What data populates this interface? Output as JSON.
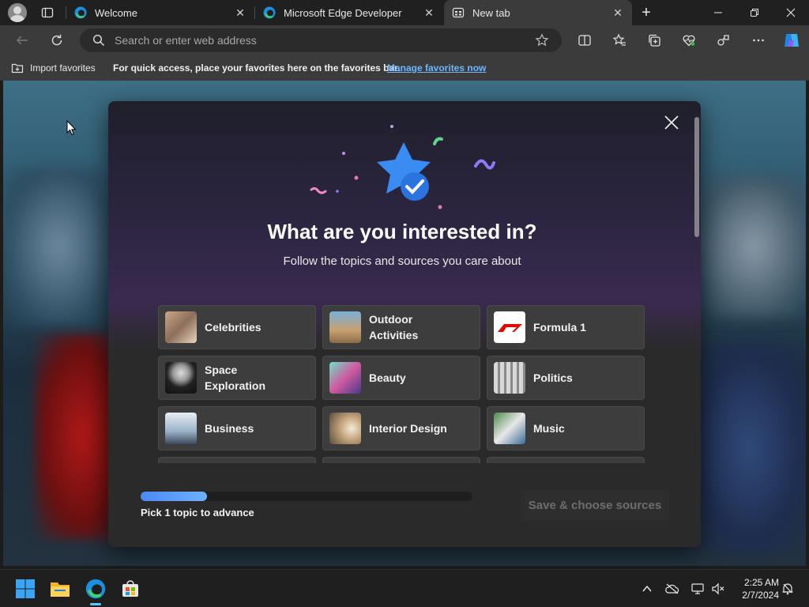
{
  "tabs": [
    {
      "title": "Welcome",
      "active": false
    },
    {
      "title": "Microsoft Edge Developer",
      "active": false
    },
    {
      "title": "New tab",
      "active": true
    }
  ],
  "addressbar": {
    "placeholder": "Search or enter web address"
  },
  "favorites_bar": {
    "import_label": "Import favorites",
    "message": "For quick access, place your favorites here on the favorites bar.",
    "link": "Manage favorites now"
  },
  "modal": {
    "title": "What are you interested in?",
    "subtitle": "Follow the topics and sources you care about",
    "topics": [
      {
        "label": "Celebrities"
      },
      {
        "label": "Outdoor Activities"
      },
      {
        "label": "Formula 1"
      },
      {
        "label": "Space Exploration"
      },
      {
        "label": "Beauty"
      },
      {
        "label": "Politics"
      },
      {
        "label": "Business"
      },
      {
        "label": "Interior Design"
      },
      {
        "label": "Music"
      }
    ],
    "progress_fraction": 0.2,
    "progress_text": "Pick 1 topic to advance",
    "save_label": "Save & choose sources"
  },
  "taskbar": {
    "time": "2:25 AM",
    "date": "2/7/2024"
  },
  "colors": {
    "accent": "#4a8af4",
    "link": "#6fb6ff",
    "f1_red": "#e10600"
  }
}
